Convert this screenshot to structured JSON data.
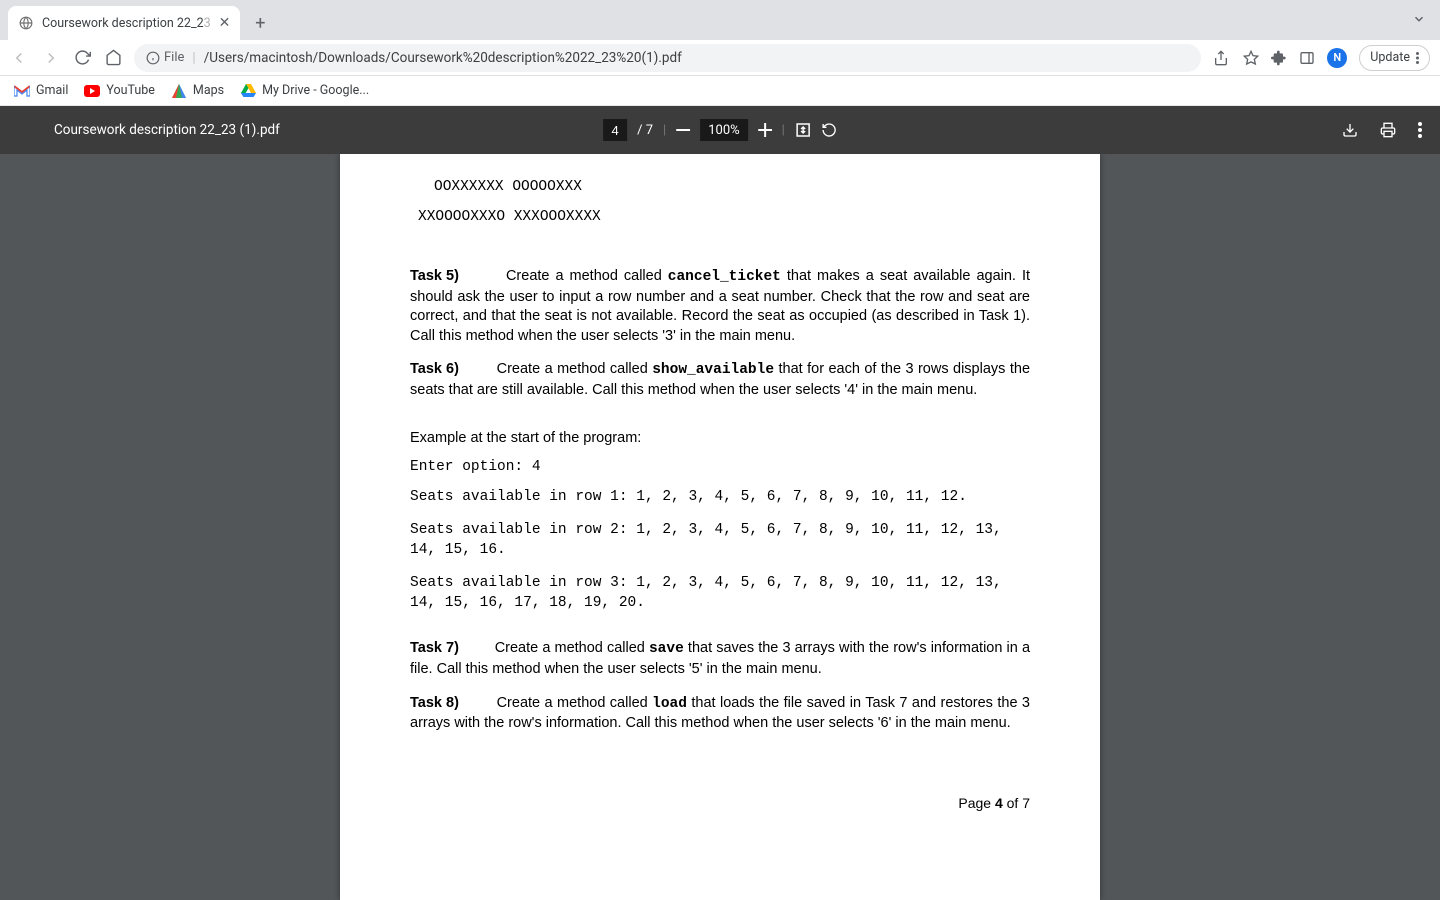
{
  "browser": {
    "tab_title_visible": "Coursework description 22_2",
    "tab_title_faded": "3",
    "new_tab_glyph": "+",
    "update_button": "Update",
    "omnibox_scheme": "File",
    "omnibox_path": "/Users/macintosh/Downloads/Coursework%20description%2022_23%20(1).pdf",
    "profile_initial": "N"
  },
  "bookmarks": [
    {
      "name": "Gmail"
    },
    {
      "name": "YouTube"
    },
    {
      "name": "Maps"
    },
    {
      "name": "My Drive - Google..."
    }
  ],
  "pdfbar": {
    "filename": "Coursework description 22_23 (1).pdf",
    "page_current": "4",
    "page_total": "/ 7",
    "zoom": "100%"
  },
  "doc": {
    "seat_art_1": "OOXXXXXX OOOOOXXX",
    "seat_art_2": "XXOOOOXXXO XXXOOOXXXX",
    "task5_label": "Task 5)",
    "task5_pre": "Create a method called ",
    "task5_code": "cancel_ticket",
    "task5_post": " that makes a seat available again. It should ask the user to input a row number and a seat number. Check that the row and seat are correct, and that the seat is not available. Record the seat as occupied (as described in Task 1). Call this method when the user selects '3' in the main menu.",
    "task6_label": "Task 6)",
    "task6_pre": "Create a method called ",
    "task6_code": "show_available",
    "task6_post": " that for each of the 3 rows displays the seats that are still available. Call this method when the user selects '4' in the main menu.",
    "example_heading": "Example at the start of the program:",
    "enter_option": "Enter option: 4",
    "row1": "Seats available in row 1: 1, 2, 3, 4, 5, 6, 7, 8, 9, 10, 11, 12.",
    "row2": "Seats available in row 2: 1, 2, 3, 4, 5, 6, 7, 8, 9, 10, 11, 12, 13, 14, 15, 16.",
    "row3": "Seats available in row 3: 1, 2, 3, 4, 5, 6, 7, 8, 9, 10, 11, 12, 13, 14, 15, 16, 17, 18, 19, 20.",
    "task7_label": "Task 7)",
    "task7_pre": "Create a method called ",
    "task7_code": "save",
    "task7_post": " that saves the 3 arrays with the row's information in a file. Call this method when the user selects '5' in the main menu.",
    "task8_label": "Task 8)",
    "task8_pre": "Create a method called ",
    "task8_code": "load",
    "task8_post": " that loads the file saved in Task 7 and restores the 3 arrays with the row's information. Call this method when the user selects '6' in the main menu.",
    "footer_pre": "Page ",
    "footer_num": "4",
    "footer_post": " of 7"
  }
}
